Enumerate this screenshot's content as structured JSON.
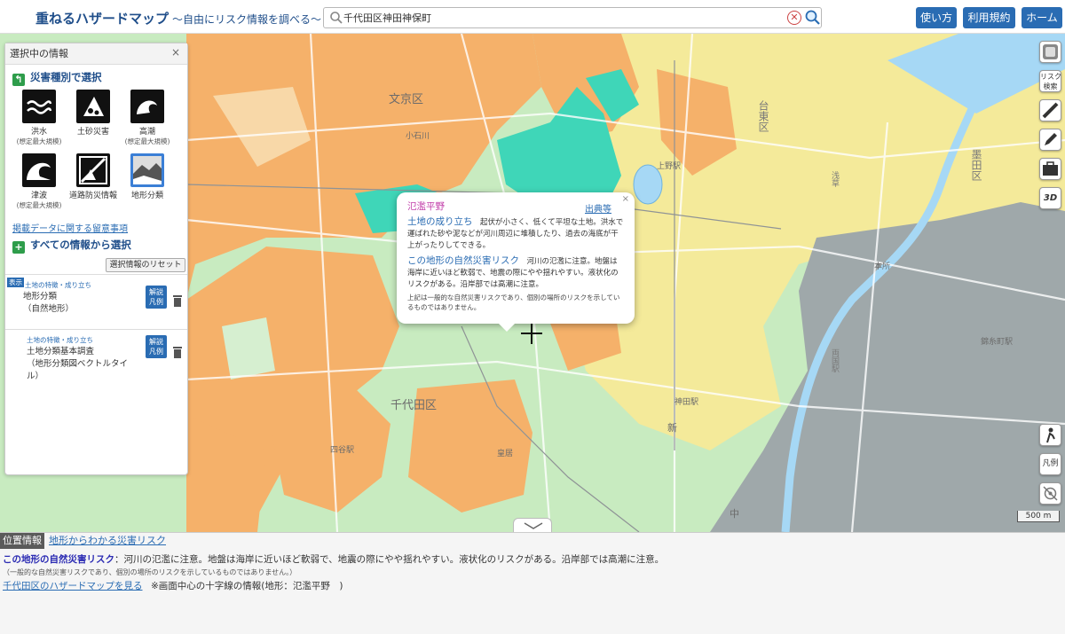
{
  "header": {
    "title": "重ねるハザードマップ",
    "subtitle": "～自由にリスク情報を調べる～",
    "search_value": "千代田区神田神保町",
    "buttons": [
      "使い方",
      "利用規約",
      "ホーム"
    ]
  },
  "side_panel": {
    "title": "選択中の情報",
    "close": "×",
    "by_type_title": "災害種別で選択",
    "hazards": [
      {
        "label": "洪水",
        "sub": "(想定最大規模)",
        "icon": "flood-icon"
      },
      {
        "label": "土砂災害",
        "sub": "",
        "icon": "landslide-icon"
      },
      {
        "label": "高潮",
        "sub": "(想定最大規模)",
        "icon": "storm-surge-icon"
      },
      {
        "label": "津波",
        "sub": "(想定最大規模)",
        "icon": "tsunami-icon"
      },
      {
        "label": "道路防災情報",
        "sub": "",
        "icon": "road-hazard-icon"
      },
      {
        "label": "地形分類",
        "sub": "",
        "icon": "landform-icon",
        "selected": true
      }
    ],
    "notes_link": "掲載データに関する留意事項",
    "all_info_title": "すべての情報から選択",
    "reset_button": "選択情報のリセット",
    "layers": [
      {
        "badge": "表示",
        "category": "土地の特徴・成り立ち",
        "name": "地形分類\n（自然地形）",
        "btn": "解説\n凡例"
      },
      {
        "badge": "",
        "category": "土地の特徴・成り立ち",
        "name": "土地分類基本調査\n（地形分類図ベクトルタイ\nル）",
        "btn": "解説\n凡例"
      }
    ]
  },
  "map_labels": {
    "bunkyo": "文京区",
    "koishikawa": "小石川",
    "taito": "台東区",
    "chiyoda": "千代田区",
    "sumida": "墨田区",
    "ueno": "上野駅",
    "kanda": "神田駅",
    "yotsuya": "四谷駅",
    "kokyo": "皇居",
    "asakusa": "浅草",
    "honjo": "本所",
    "kinshicho": "錦糸町駅",
    "ryogoku": "両国駅",
    "naka": "中",
    "shin": "新"
  },
  "popup": {
    "title": "氾濫平野",
    "source_link": "出典等",
    "close": "×",
    "origin_label": "土地の成り立ち",
    "origin_text": "起伏が小さく、低くて平坦な土地。洪水で運ばれた砂や泥などが河川周辺に堆積したり、過去の海底が干上がったりしてできる。",
    "risk_label": "この地形の自然災害リスク",
    "risk_text": "河川の氾濫に注意。地盤は海岸に近いほど軟弱で、地震の際にやや揺れやすい。液状化のリスクがある。沿岸部では高潮に注意。",
    "disclaimer": "上記は一般的な自然災害リスクであり、個別の場所のリスクを示しているものではありません。"
  },
  "right_tools": [
    "layers-icon",
    "リスク\n検索",
    "ruler-icon",
    "pencil-icon",
    "toolbox-icon",
    "3D"
  ],
  "right_tools_lower": [
    "person-icon",
    "凡例",
    "gps-icon"
  ],
  "scale_label": "500 m",
  "bottom": {
    "tab_active": "位置情報",
    "tab_other": "地形からわかる災害リスク",
    "risk_label": "この地形の自然災害リスク",
    "risk_text": "：河川の氾濫に注意。地盤は海岸に近いほど軟弱で、地震の際にやや揺れやすい。液状化のリスクがある。沿岸部では高潮に注意。",
    "fine_print": "（一般的な自然災害リスクであり、個別の場所のリスクを示しているものではありません。）",
    "link": "千代田区のハザードマップを見る",
    "center_info": "※画面中心の十字線の情報(地形：氾濫平野　)"
  },
  "colors": {
    "terrace_orange": "#f5b16a",
    "lowland_green": "#c8ebc0",
    "valley_teal": "#3fd6b8",
    "reclaimed_gray": "#9fa8aa",
    "floodplain_yellow": "#f4ea9a",
    "accent_blue": "#2a6cb3"
  }
}
